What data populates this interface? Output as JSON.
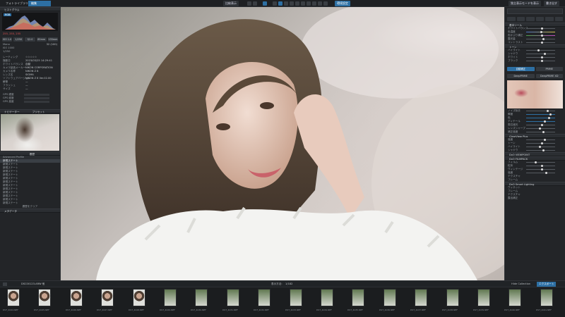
{
  "topbar": {
    "tab_library": "フォトライブラリ",
    "tab_edit": "編集",
    "compare_label": "比較表示",
    "tool_label": "□",
    "pref_label": "環境設定",
    "right1": "独立表示モードを表示",
    "right2": "書き出す"
  },
  "left": {
    "histogram_title": "ヒストグラム",
    "hist_channel": "RGB",
    "rgb_values": "255,  255,  255",
    "rows1": [
      {
        "k": "Mono",
        "v": "32 (100)"
      },
      {
        "k": "ISO 1000",
        "v": ""
      },
      {
        "k": "1/250",
        "v": ""
      }
    ],
    "modes": [
      "ISO 1.0",
      "1/250",
      "f/2.0",
      "85mm",
      "135mm"
    ],
    "info_rows": [
      {
        "k": "レーティング",
        "v": "☆☆☆☆☆"
      },
      {
        "k": "撮影日",
        "v": "2023/03/25 14:29:41"
      },
      {
        "k": "ホワイトバランス",
        "v": "自動"
      },
      {
        "k": "カメラ製造メーカー",
        "v": "NIKON CORPORATION"
      },
      {
        "k": "カメラ名称",
        "v": "NIKON Z 8"
      },
      {
        "k": "レンズ名",
        "v": "SIGMA"
      },
      {
        "k": "ソフトウェアバージョン",
        "v": "NIKON Z 8 Ver.02.00"
      },
      {
        "k": "解像",
        "v": "—"
      },
      {
        "k": "フラッシュ",
        "v": "—"
      },
      {
        "k": "サイズ",
        "v": "—"
      }
    ],
    "gps_rows": [
      "GPS 緯度",
      "GPS 経度",
      "GPS 高度"
    ],
    "nav_title": "ナビゲーター",
    "presets_title": "プリセット",
    "history_title": "履歴",
    "history_head": "Advanced Profile",
    "history_items": [
      "新規ステート",
      "新規ステート",
      "新規ステート",
      "新規ステート",
      "新規ステート",
      "新規ステート",
      "新規ステート",
      "新規ステート",
      "新規ステート",
      "新規ステート",
      "新規ステート",
      "新規ステート",
      "新規ステート"
    ],
    "history_footer": "履歴をクリア",
    "bottom_title": "メタデータ"
  },
  "right": {
    "search_placeholder": "",
    "section_basic": "基本ツール",
    "basic_rows": [
      "ホワイトバランス",
      "色温度",
      "色かぶり補正",
      "露光量",
      "コントラスト"
    ],
    "section_tone": "トーン",
    "tone_rows": [
      "ハイライト",
      "シャドウ",
      "ホワイト",
      "ブラック"
    ],
    "lens_tabs": [
      "自動補正",
      "PRIME"
    ],
    "lens_sub": [
      "DeepPRIME",
      "DeepPRIME XD"
    ],
    "detail_rows": [
      "ノイズ除去",
      "輝度",
      "色",
      "ディテール",
      "周辺減光",
      "レンズシャープ",
      "補正強度"
    ],
    "section_clear": "ClearView Plus",
    "clear_rows": [
      "強度",
      "トーン",
      "ハイライト",
      "シャドウ"
    ],
    "film_pack": "DxO FILMPACK",
    "viewpoint": "DxO VIEWPOINT",
    "film_rows": [
      "フィルム",
      "粒状",
      "ヴィンテージ",
      "強度",
      "テクスチャ",
      "フレーム"
    ],
    "smart": "DxO Smart Lighting",
    "bottom_rows": [
      "ヴィネット",
      "フレーム",
      "テクスチャ",
      "露出補正"
    ]
  },
  "filmbar": {
    "left_label": "DSC00123.ARW 他",
    "center_label": "表示方法:",
    "center_val": "1/182",
    "right_label": "Hide Collection",
    "right_btn": "エクスポート"
  },
  "thumbs": [
    {
      "label": "DST_4024.NEF",
      "kind": "p",
      "mark": "—"
    },
    {
      "label": "DST_4025.NEF",
      "kind": "p",
      "mark": "—"
    },
    {
      "label": "DST_4026.NEF",
      "kind": "p",
      "mark": "—"
    },
    {
      "label": "DST_4027.NEF",
      "kind": "p",
      "mark": "—"
    },
    {
      "label": "DST_4028.NEF",
      "kind": "p",
      "mark": "—"
    },
    {
      "label": "DST_4029.NEF",
      "kind": "g",
      "mark": "—"
    },
    {
      "label": "DST_4030.NEF",
      "kind": "g",
      "mark": "—"
    },
    {
      "label": "DST_4031.NEF",
      "kind": "g",
      "mark": "—"
    },
    {
      "label": "DST_4032.NEF",
      "kind": "g",
      "mark": "—"
    },
    {
      "label": "DST_4033.NEF",
      "kind": "g",
      "mark": "—"
    },
    {
      "label": "DST_4034.NEF",
      "kind": "g",
      "mark": "—"
    },
    {
      "label": "DST_4035.NEF",
      "kind": "g",
      "mark": "—"
    },
    {
      "label": "DST_4036.NEF",
      "kind": "g",
      "mark": "—"
    },
    {
      "label": "DST_4037.NEF",
      "kind": "g",
      "mark": "—"
    },
    {
      "label": "DST_4038.NEF",
      "kind": "g",
      "mark": "—"
    },
    {
      "label": "DST_4039.NEF",
      "kind": "g",
      "mark": "—"
    },
    {
      "label": "DST_4040.NEF",
      "kind": "g",
      "mark": "—"
    },
    {
      "label": "DST_4041.NEF",
      "kind": "g",
      "mark": "—"
    }
  ]
}
